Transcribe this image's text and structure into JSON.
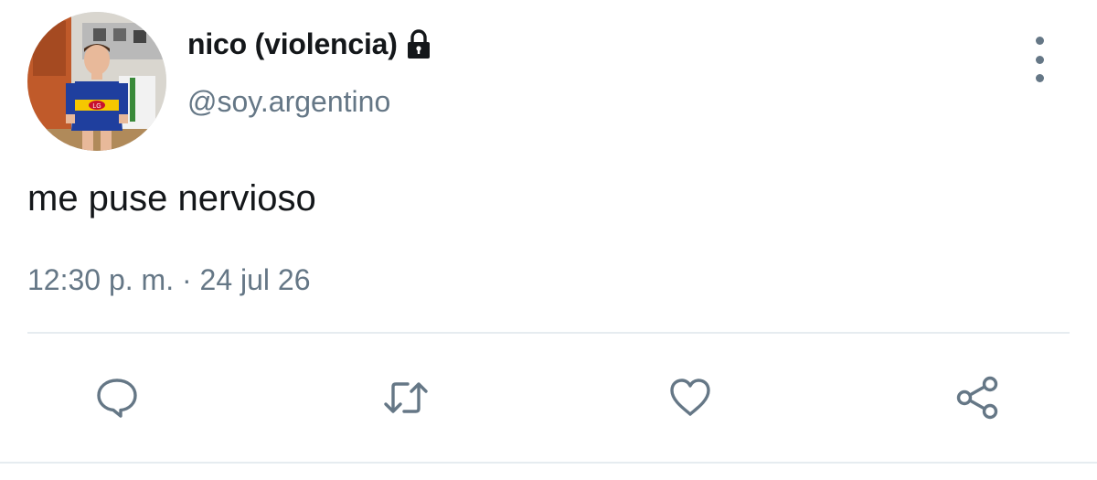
{
  "tweet": {
    "display_name": "nico (violencia)",
    "handle": "@soy.argentino",
    "text": "me puse nervioso",
    "timestamp": "12:30 p. m. · 24 jul 26",
    "protected_icon": "lock-icon",
    "avatar_jersey_text": "LG"
  },
  "actions": [
    {
      "icon": "reply-icon"
    },
    {
      "icon": "retweet-icon"
    },
    {
      "icon": "like-icon"
    },
    {
      "icon": "share-icon"
    }
  ],
  "colors": {
    "text_primary": "#14171a",
    "text_secondary": "#657786",
    "divider": "#e6ecf0",
    "jersey_blue": "#1f3f9e",
    "jersey_yellow": "#f6c700"
  }
}
